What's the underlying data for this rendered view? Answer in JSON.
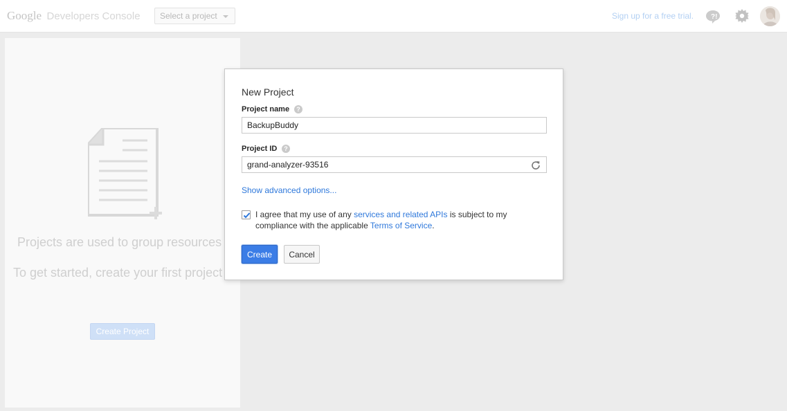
{
  "header": {
    "brand": "Google",
    "product": "Developers Console",
    "project_select": "Select a project",
    "signup_link": "Sign up for a free trial.",
    "icons": [
      "feedback-icon",
      "gear-icon",
      "avatar"
    ]
  },
  "empty_state": {
    "line1": "Projects are used to group resources",
    "line2": "To get started, create your first project",
    "create_button": "Create Project"
  },
  "dialog": {
    "title": "New Project",
    "project_name_label": "Project name",
    "project_name_value": "BackupBuddy",
    "project_id_label": "Project ID",
    "project_id_value": "grand-analyzer-93516",
    "advanced_link": "Show advanced options...",
    "agree": {
      "checked": true,
      "text_before": "I agree that my use of any ",
      "link1": "services and related APIs",
      "text_middle": " is subject to my compliance with the applicable ",
      "link2": "Terms of Service",
      "text_after": "."
    },
    "create_button": "Create",
    "cancel_button": "Cancel"
  },
  "colors": {
    "accent": "#3b7de6",
    "link": "#2e78db",
    "help_icon": "#cacaca"
  }
}
